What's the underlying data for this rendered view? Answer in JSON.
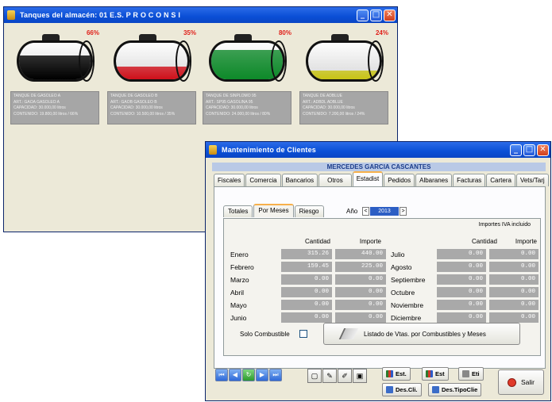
{
  "tanks_window": {
    "title": "Tanques del almacén: 01 E.S.  P R O C O N S I",
    "tanks": [
      {
        "percent_label": "66%",
        "level": 0.66,
        "fill_color": "#000000",
        "info": [
          "TANQUE DE GASOLEO A",
          "ART.: GAOA          GASOLEO A",
          "CAPACIDAD: 30.000,00 litros",
          "CONTENIDO: 19.800,00 litros / 66%"
        ]
      },
      {
        "percent_label": "35%",
        "level": 0.35,
        "fill_color": "#d0101a",
        "info": [
          "TANQUE DE GASOLEO B",
          "ART.: GAOB          GASOLEO B",
          "CAPACIDAD: 30.000,00 litros",
          "CONTENIDO: 10.500,00 litros / 35%"
        ]
      },
      {
        "percent_label": "80%",
        "level": 0.8,
        "fill_color": "#0e8a2a",
        "info": [
          "TANQUE DE SINPLOMO 95",
          "ART.: SP95          GASOLINA 95",
          "CAPACIDAD: 30.000,00 litros",
          "CONTENIDO: 24.000,00 litros / 80%"
        ]
      },
      {
        "percent_label": "24%",
        "level": 0.24,
        "fill_color": "#c8c414",
        "info": [
          "TANQUE DE ADBLUE",
          "ART.: ADBDL          ADBLUE",
          "CAPACIDAD: 30.000,00 litros",
          "CONTENIDO: 7.200,00 litros / 24%"
        ]
      }
    ]
  },
  "clients_window": {
    "title": "Mantenimiento de Clientes",
    "customer_name": "MERCEDES GARCIA CASCANTES",
    "tabs": [
      "Fiscales",
      "Comercia",
      "Bancarios",
      "Otros",
      "Estadist",
      "Pedidos",
      "Albaranes",
      "Facturas",
      "Cartera",
      "Vets/Tarj"
    ],
    "active_tab": "Estadist",
    "subtabs": [
      "Totales",
      "Por Meses",
      "Riesgo"
    ],
    "active_subtab": "Por Meses",
    "year_label": "Año",
    "year_value": "2013",
    "iva_note": "Importes IVA incluido",
    "col_cantidad": "Cantidad",
    "col_importe": "Importe",
    "months_left": [
      {
        "name": "Enero",
        "cantidad": "315.26",
        "importe": "440.00"
      },
      {
        "name": "Febrero",
        "cantidad": "159.45",
        "importe": "225.00"
      },
      {
        "name": "Marzo",
        "cantidad": "0.00",
        "importe": "0.00"
      },
      {
        "name": "Abril",
        "cantidad": "0.00",
        "importe": "0.00"
      },
      {
        "name": "Mayo",
        "cantidad": "0.00",
        "importe": "0.00"
      },
      {
        "name": "Junio",
        "cantidad": "0.00",
        "importe": "0.00"
      }
    ],
    "months_right": [
      {
        "name": "Julio",
        "cantidad": "0.00",
        "importe": "0.00"
      },
      {
        "name": "Agosto",
        "cantidad": "0.00",
        "importe": "0.00"
      },
      {
        "name": "Septiembre",
        "cantidad": "0.00",
        "importe": "0.00"
      },
      {
        "name": "Octubre",
        "cantidad": "0.00",
        "importe": "0.00"
      },
      {
        "name": "Noviembre",
        "cantidad": "0.00",
        "importe": "0.00"
      },
      {
        "name": "Diciembre",
        "cantidad": "0.00",
        "importe": "0.00"
      }
    ],
    "solo_combustible_label": "Solo Combustible",
    "listado_button": "Listado de Vtas. por Combustibles y Meses",
    "btn_est": "Est.",
    "btn_eti_est": "Est",
    "btn_eti": "Eti",
    "btn_des_cli": "Des.Cli.",
    "btn_des_tipo": "Des.TipoClie",
    "btn_salir": "Salir"
  }
}
